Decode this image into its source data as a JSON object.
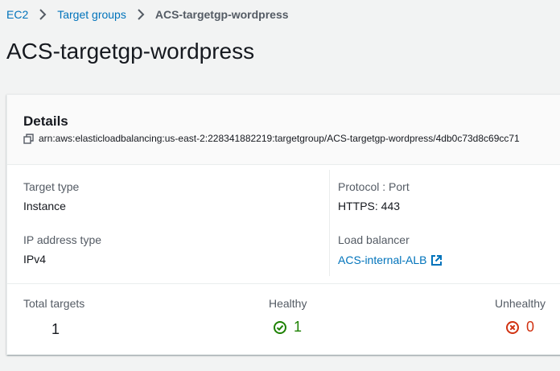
{
  "breadcrumb": {
    "items": [
      {
        "label": "EC2"
      },
      {
        "label": "Target groups"
      }
    ],
    "current": "ACS-targetgp-wordpress"
  },
  "page": {
    "title": "ACS-targetgp-wordpress"
  },
  "details": {
    "title": "Details",
    "arn": "arn:aws:elasticloadbalancing:us-east-2:228341882219:targetgroup/ACS-targetgp-wordpress/4db0c73d8c69cc71",
    "target_type": {
      "label": "Target type",
      "value": "Instance"
    },
    "protocol_port": {
      "label": "Protocol : Port",
      "value": "HTTPS: 443"
    },
    "ip_address_type": {
      "label": "IP address type",
      "value": "IPv4"
    },
    "load_balancer": {
      "label": "Load balancer",
      "value": "ACS-internal-ALB"
    }
  },
  "targets": {
    "total": {
      "label": "Total targets",
      "value": "1"
    },
    "healthy": {
      "label": "Healthy",
      "value": "1"
    },
    "unhealthy": {
      "label": "Unhealthy",
      "value": "0"
    }
  },
  "colors": {
    "link": "#0073bb",
    "healthy": "#1d8102",
    "unhealthy": "#d13212"
  },
  "icons": {
    "breadcrumb_separator": "chevron-right-icon",
    "arn_copy": "copy-icon",
    "external_link": "external-link-icon",
    "healthy_status": "check-circle-icon",
    "unhealthy_status": "x-circle-icon"
  }
}
